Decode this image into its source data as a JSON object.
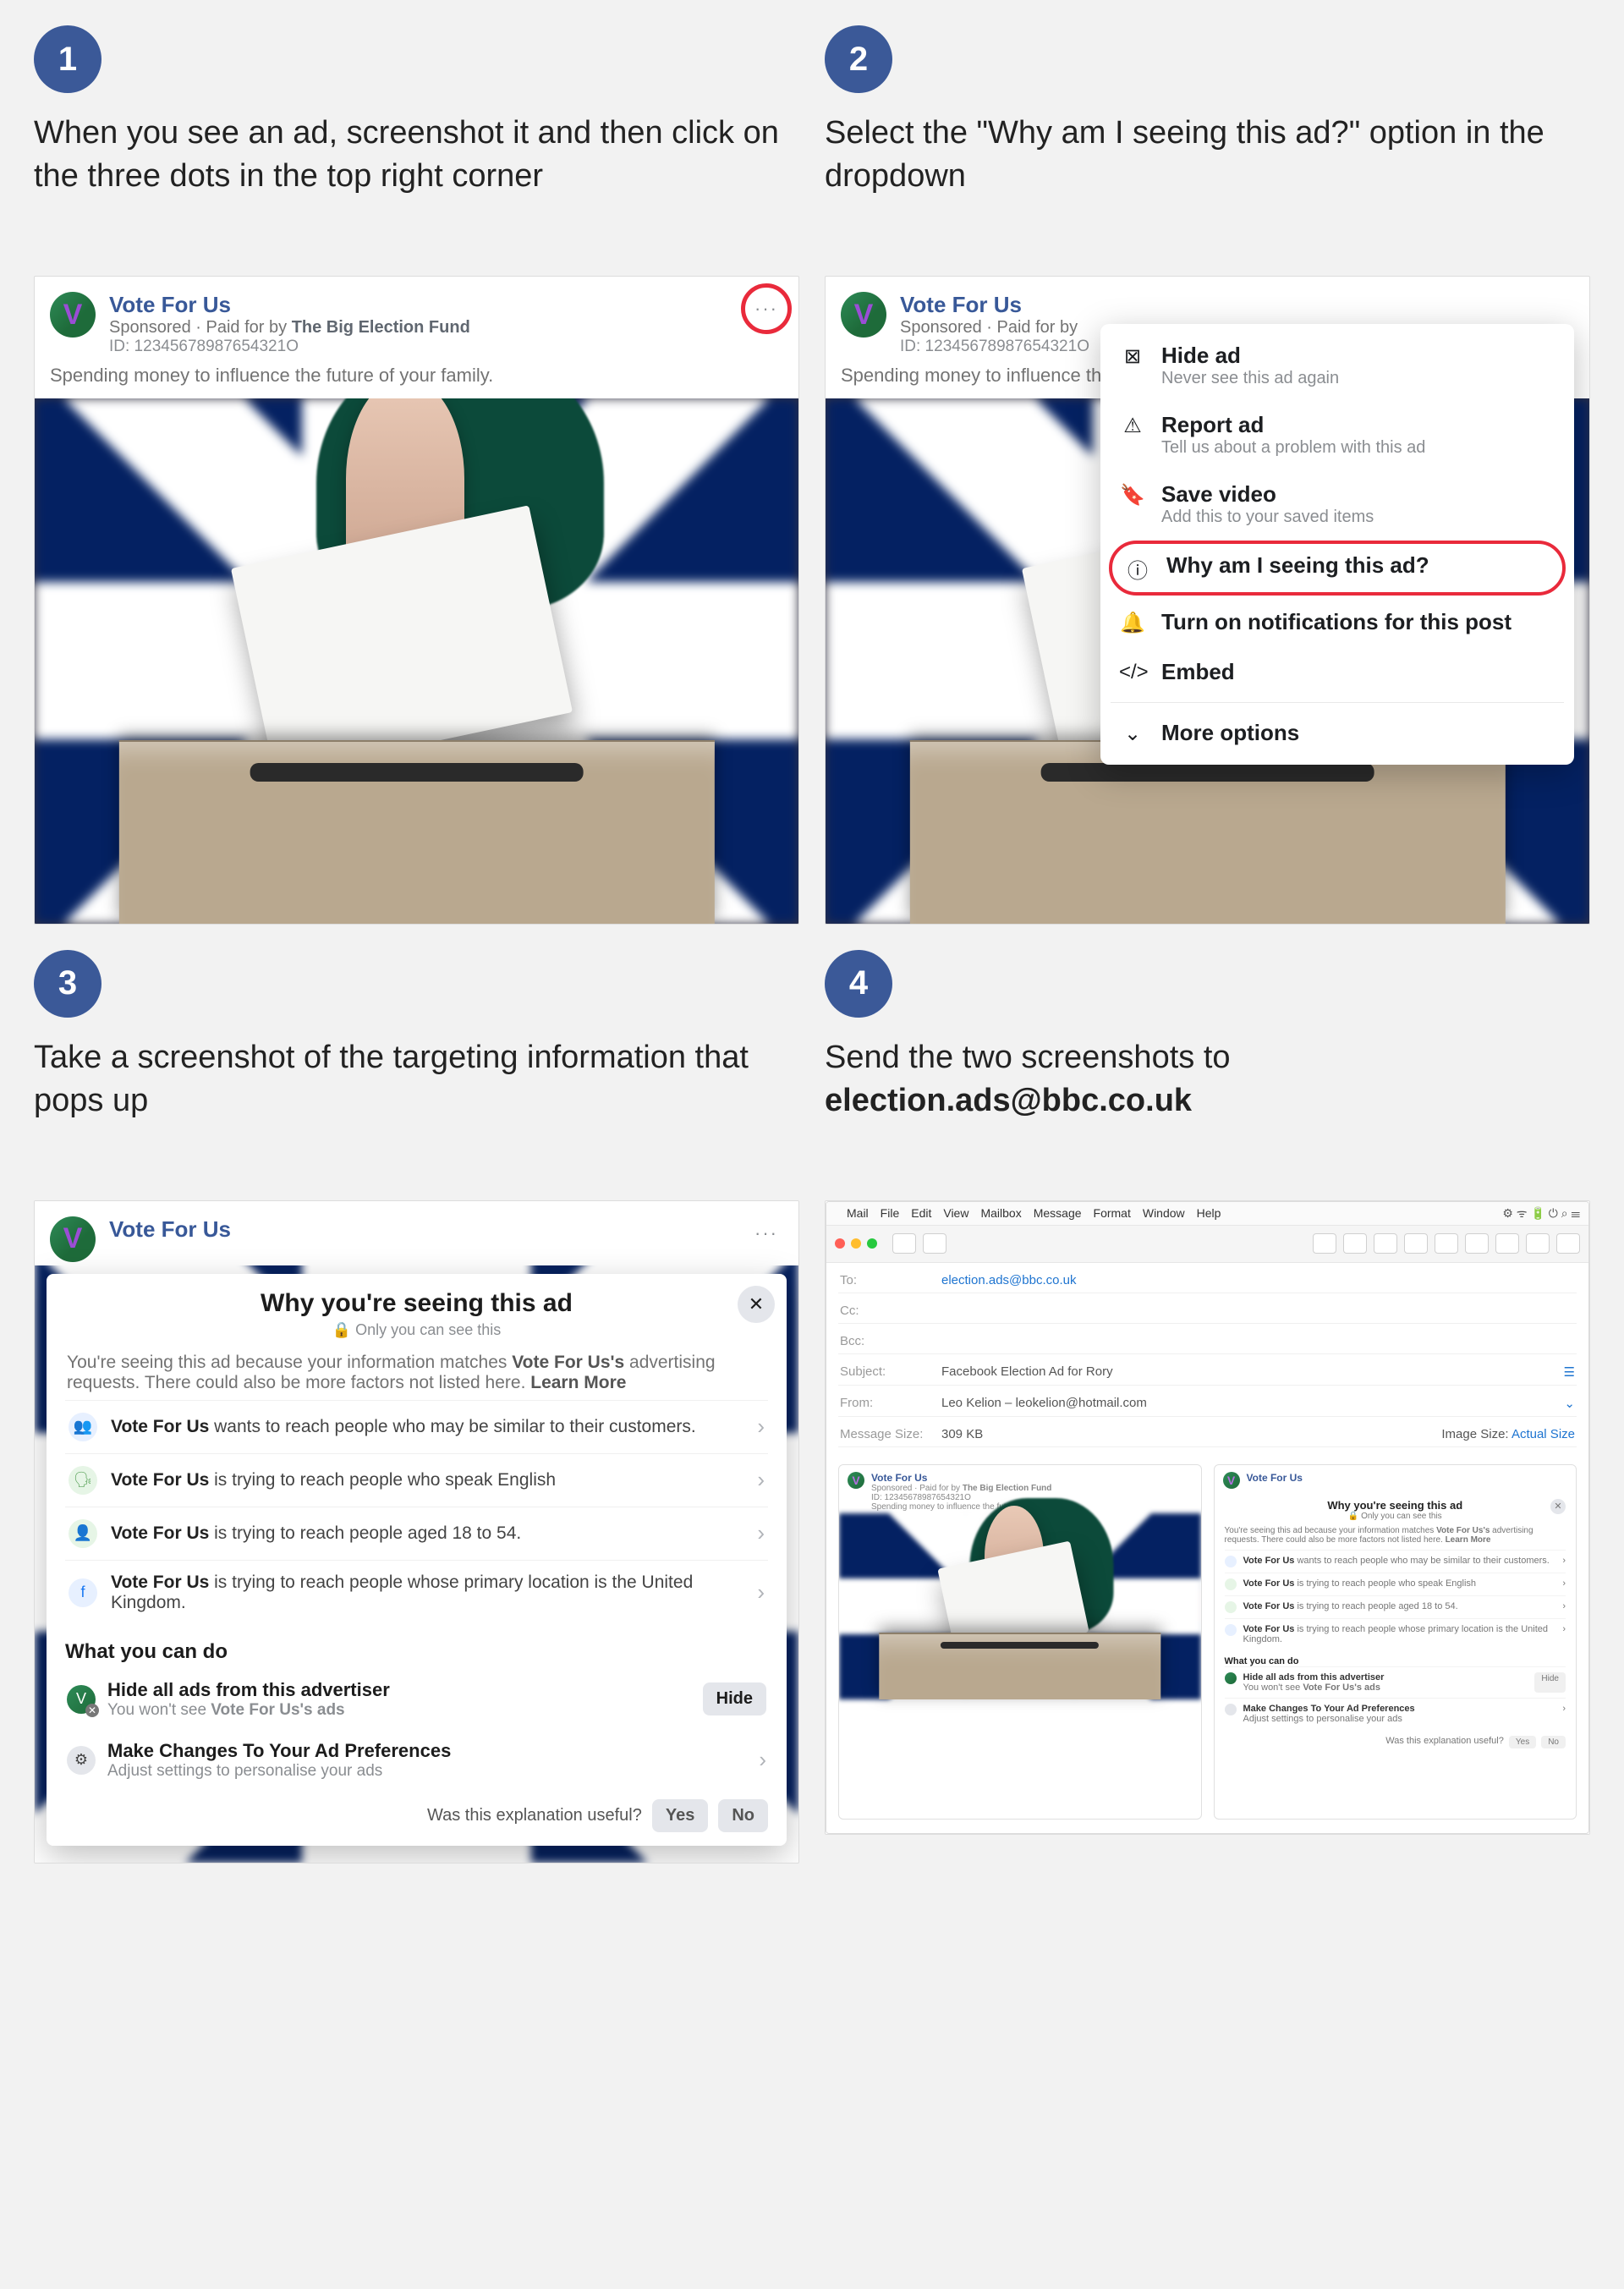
{
  "steps": {
    "s1": {
      "number": "1",
      "text": "When you see an ad, screenshot it and then click on the three dots in the top right corner"
    },
    "s2": {
      "number": "2",
      "text": "Select the \"Why am I seeing this ad?\" option in the dropdown"
    },
    "s3": {
      "number": "3",
      "text": "Take a screenshot of the targeting information that pops up"
    },
    "s4": {
      "number": "4",
      "text_prefix": "Send the two screenshots to ",
      "email": "election.ads@bbc.co.uk"
    }
  },
  "ad": {
    "page_name": "Vote For Us",
    "avatar_letter": "V",
    "sponsored_prefix": "Sponsored · Paid for by ",
    "paid_for_by": "The Big Election Fund",
    "ad_id": "ID: 12345678987654321O",
    "body": "Spending money to influence the future of your family.",
    "dots": "···"
  },
  "dropdown": {
    "hide": {
      "title": "Hide ad",
      "subtitle": "Never see this ad again"
    },
    "report": {
      "title": "Report ad",
      "subtitle": "Tell us about a problem with this ad"
    },
    "save": {
      "title": "Save video",
      "subtitle": "Add this to your saved items"
    },
    "why": {
      "title": "Why am I seeing this ad?"
    },
    "notify": {
      "title": "Turn on notifications for this post"
    },
    "embed": {
      "title": "Embed"
    },
    "more": {
      "title": "More options"
    }
  },
  "why_modal": {
    "title": "Why you're seeing this ad",
    "privacy": "Only you can see this",
    "close": "✕",
    "explain_prefix": "You're seeing this ad because your information matches ",
    "explain_page": "Vote For Us's",
    "explain_suffix_a": " advertising requests. There could also be more factors not listed here. ",
    "learn_more": "Learn More",
    "rows": [
      {
        "bold": "Vote For Us",
        "after": " wants to reach people who may be similar to their customers."
      },
      {
        "bold": "Vote For Us",
        "after": " is trying to reach people who speak English"
      },
      {
        "bold": "Vote For Us",
        "after": " is trying to reach people aged 18 to 54."
      },
      {
        "bold": "Vote For Us",
        "after": " is trying to reach people whose primary location is the United Kingdom."
      }
    ],
    "wycd": "What you can do",
    "hide_ads": {
      "title": "Hide all ads from this advertiser",
      "subtitle_prefix": "You won't see ",
      "subtitle_bold": "Vote For Us's ads",
      "button": "Hide"
    },
    "prefs": {
      "title": "Make Changes To Your Ad Preferences",
      "subtitle": "Adjust settings to personalise your ads"
    },
    "useful_q": "Was this explanation useful?",
    "yes": "Yes",
    "no": "No"
  },
  "mail": {
    "menus": [
      "",
      "Mail",
      "File",
      "Edit",
      "View",
      "Mailbox",
      "Message",
      "Format",
      "Window",
      "Help"
    ],
    "status_icons": "⚙ ᯤ 🔋 ⏻ ⌕ ☰",
    "to_label": "To:",
    "to_value": "election.ads@bbc.co.uk",
    "cc_label": "Cc:",
    "bcc_label": "Bcc:",
    "subject_label": "Subject:",
    "subject_value": "Facebook Election Ad for Rory",
    "from_label": "From:",
    "from_value": "Leo Kelion – leokelion@hotmail.com",
    "size_label": "Message Size:",
    "size_value": "309 KB",
    "image_size_label": "Image Size:",
    "image_size_value": "Actual Size"
  }
}
